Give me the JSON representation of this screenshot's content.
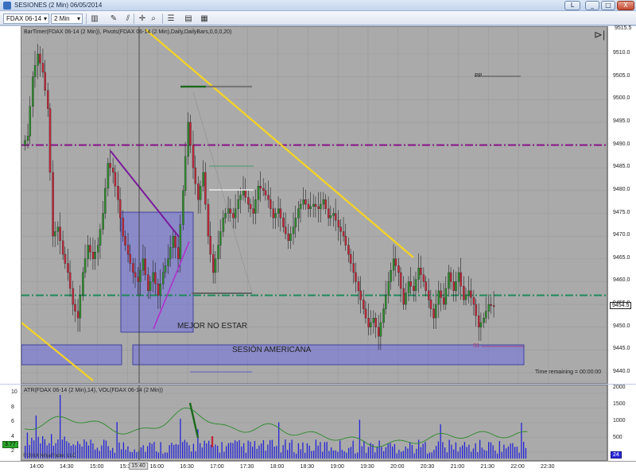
{
  "window": {
    "title": "SESIONES (2 Min)  06/05/2014",
    "minimize_label": "_",
    "restore_label": "L",
    "close_label": "X"
  },
  "toolbar": {
    "instrument": "FDAX 06-14",
    "interval": "2 Min",
    "dropdown_glyph": "▾"
  },
  "chart": {
    "indicator_label": "BarTimer(FDAX 06-14 (2 Min)), Pivots(FDAX 06-14 (2 Min),Daily,DailyBars,0,0,0,20)",
    "pp_label": "PP",
    "s1_label": "S1",
    "text_mejor": "MEJOR NO ESTAR",
    "text_sesion": "SESIÓN AMERICANA",
    "time_remaining": "Time remaining = 00:00:00",
    "current_price": "9454.5",
    "top_price": "9515.5",
    "colors": {
      "up_candle": "#2e8b2e",
      "down_candle": "#c0283a",
      "yellow_line": "#f2d22a",
      "purple_line": "#8b1a8b",
      "green_dash": "#1f8a5a",
      "box_fill": "#6f6fe0",
      "grid": "#9a9a9a"
    },
    "price_ticks": [
      "9510.0",
      "9505.0",
      "9500.0",
      "9495.0",
      "9490.0",
      "9485.0",
      "9480.0",
      "9475.0",
      "9470.0",
      "9465.0",
      "9460.0",
      "9455.0",
      "9450.0",
      "9445.0",
      "9440.0"
    ]
  },
  "subchart": {
    "label": "ATR(FDAX 06-14 (2 Min),14), VOL(FDAX 06-14 (2 Min))",
    "copyright": "© 2014 NinjaTrader, LLC",
    "atr_value": "3.77",
    "vol_value": "24",
    "left_ticks": [
      "10",
      "8",
      "6",
      "4",
      "2"
    ],
    "right_ticks": [
      "2000",
      "1500",
      "1000",
      "500"
    ]
  },
  "time_axis": {
    "ticks": [
      "14:00",
      "14:30",
      "15:00",
      "15:30",
      "16:00",
      "16:30",
      "17:00",
      "17:30",
      "18:00",
      "18:30",
      "19:00",
      "19:30",
      "20:00",
      "20:30",
      "21:00",
      "21:30",
      "22:00",
      "22:30"
    ],
    "cursor_time": "15:40"
  },
  "chart_data": {
    "type": "candlestick",
    "title": "SESIONES (2 Min)  06/05/2014",
    "ylim": [
      9438,
      9517
    ],
    "x_range": [
      "13:45",
      "22:45"
    ],
    "series": [
      {
        "name": "FDAX 06-14",
        "close_path": [
          [
            "13:50",
            9492
          ],
          [
            "13:55",
            9505
          ],
          [
            "14:00",
            9510
          ],
          [
            "14:05",
            9506
          ],
          [
            "14:10",
            9498
          ],
          [
            "14:15",
            9470
          ],
          [
            "14:20",
            9472
          ],
          [
            "14:25",
            9466
          ],
          [
            "14:30",
            9462
          ],
          [
            "14:35",
            9455
          ],
          [
            "14:40",
            9452
          ],
          [
            "14:45",
            9462
          ],
          [
            "14:50",
            9468
          ],
          [
            "14:55",
            9465
          ],
          [
            "15:00",
            9468
          ],
          [
            "15:05",
            9475
          ],
          [
            "15:10",
            9486
          ],
          [
            "15:15",
            9484
          ],
          [
            "15:20",
            9478
          ],
          [
            "15:25",
            9470
          ],
          [
            "15:30",
            9466
          ],
          [
            "15:35",
            9462
          ],
          [
            "15:40",
            9460
          ],
          [
            "15:45",
            9465
          ],
          [
            "15:50",
            9458
          ],
          [
            "15:55",
            9462
          ],
          [
            "16:00",
            9457
          ],
          [
            "16:05",
            9462
          ],
          [
            "16:10",
            9465
          ],
          [
            "16:15",
            9470
          ],
          [
            "16:20",
            9465
          ],
          [
            "16:25",
            9480
          ],
          [
            "16:30",
            9495
          ],
          [
            "16:35",
            9485
          ],
          [
            "16:40",
            9478
          ],
          [
            "16:45",
            9484
          ],
          [
            "16:50",
            9470
          ],
          [
            "16:55",
            9462
          ],
          [
            "17:00",
            9468
          ],
          [
            "17:05",
            9474
          ],
          [
            "17:10",
            9476
          ],
          [
            "17:15",
            9474
          ],
          [
            "17:20",
            9478
          ],
          [
            "17:25",
            9480
          ],
          [
            "17:30",
            9477
          ],
          [
            "17:35",
            9475
          ],
          [
            "17:40",
            9481
          ],
          [
            "17:45",
            9480
          ],
          [
            "17:50",
            9478
          ],
          [
            "17:55",
            9474
          ],
          [
            "18:00",
            9476
          ],
          [
            "18:05",
            9472
          ],
          [
            "18:10",
            9469
          ],
          [
            "18:15",
            9472
          ],
          [
            "18:20",
            9476
          ],
          [
            "18:25",
            9478
          ],
          [
            "18:30",
            9476
          ],
          [
            "18:35",
            9477
          ],
          [
            "18:40",
            9476
          ],
          [
            "18:45",
            9478
          ],
          [
            "18:50",
            9474
          ],
          [
            "18:55",
            9475
          ],
          [
            "19:00",
            9472
          ],
          [
            "19:05",
            9470
          ],
          [
            "19:10",
            9466
          ],
          [
            "19:15",
            9462
          ],
          [
            "19:20",
            9458
          ],
          [
            "19:25",
            9454
          ],
          [
            "19:30",
            9450
          ],
          [
            "19:35",
            9452
          ],
          [
            "19:40",
            9448
          ],
          [
            "19:45",
            9454
          ],
          [
            "19:50",
            9460
          ],
          [
            "19:55",
            9465
          ],
          [
            "20:00",
            9462
          ],
          [
            "20:05",
            9455
          ],
          [
            "20:10",
            9460
          ],
          [
            "20:15",
            9458
          ],
          [
            "20:20",
            9463
          ],
          [
            "20:25",
            9460
          ],
          [
            "20:30",
            9456
          ],
          [
            "20:35",
            9452
          ],
          [
            "20:40",
            9458
          ],
          [
            "20:45",
            9455
          ],
          [
            "20:50",
            9462
          ],
          [
            "20:55",
            9458
          ],
          [
            "21:00",
            9462
          ],
          [
            "21:05",
            9456
          ],
          [
            "21:10",
            9458
          ],
          [
            "21:15",
            9455
          ],
          [
            "21:20",
            9450
          ],
          [
            "21:25",
            9452
          ],
          [
            "21:30",
            9455
          ],
          [
            "21:35",
            9454.5
          ]
        ]
      }
    ],
    "reference_lines": [
      {
        "name": "purple dash-dot",
        "value": 9490
      },
      {
        "name": "green dash-dot",
        "value": 9457
      }
    ]
  }
}
